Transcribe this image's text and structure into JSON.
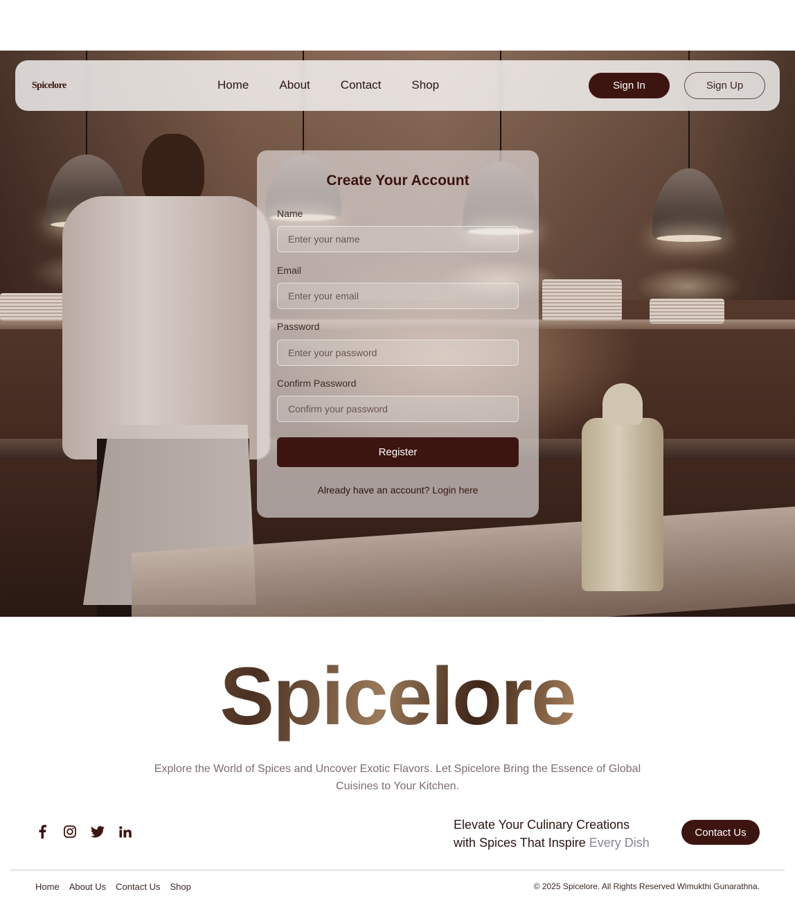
{
  "nav": {
    "logo": "Spicelore",
    "items": [
      {
        "label": "Home"
      },
      {
        "label": "About"
      },
      {
        "label": "Contact"
      },
      {
        "label": "Shop"
      }
    ],
    "signin_label": "Sign In",
    "signup_label": "Sign Up"
  },
  "form": {
    "title": "Create Your Account",
    "fields": [
      {
        "label": "Name",
        "placeholder": "Enter your name",
        "value": ""
      },
      {
        "label": "Email",
        "placeholder": "Enter your email",
        "value": ""
      },
      {
        "label": "Password",
        "placeholder": "Enter your password",
        "value": ""
      },
      {
        "label": "Confirm Password",
        "placeholder": "Confirm your password",
        "value": ""
      }
    ],
    "register_label": "Register",
    "login_prompt": "Already have an account?",
    "login_link": "Login here"
  },
  "footer": {
    "brand": "Spicelore",
    "tagline": "Explore the World of Spices and Uncover Exotic Flavors. Let Spicelore Bring the Essence of Global Cuisines to Your Kitchen.",
    "social_icons": [
      "facebook-icon",
      "instagram-icon",
      "twitter-icon",
      "linkedin-icon"
    ],
    "elevate_line1": "Elevate Your Culinary Creations",
    "elevate_line2": "with Spices That Inspire",
    "elevate_accent": "Every Dish",
    "contact_label": "Contact Us",
    "links": [
      {
        "label": "Home"
      },
      {
        "label": "About Us"
      },
      {
        "label": "Contact Us"
      },
      {
        "label": "Shop"
      }
    ],
    "copyright": "© 2025 Spicelore. All Rights Reserved Wimukthi Gunarathna."
  },
  "colors": {
    "brand_dark": "#3d1510",
    "accent_muted": "#8a8494"
  }
}
